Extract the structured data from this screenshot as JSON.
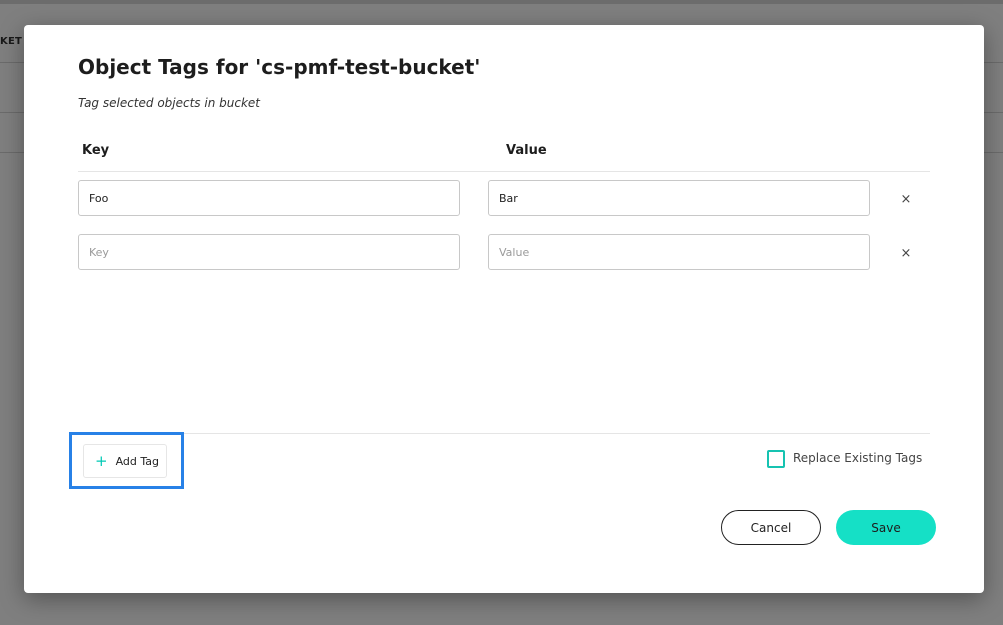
{
  "background": {
    "column_label": "KET C"
  },
  "modal": {
    "title": "Object Tags for 'cs-pmf-test-bucket'",
    "subtitle": "Tag selected objects in bucket",
    "headers": {
      "key": "Key",
      "value": "Value"
    },
    "tags": [
      {
        "key": "Foo",
        "value": "Bar",
        "key_placeholder": "Key",
        "value_placeholder": "Value",
        "remove_icon": "×"
      },
      {
        "key": "",
        "value": "",
        "key_placeholder": "Key",
        "value_placeholder": "Value",
        "remove_icon": "×"
      }
    ],
    "add_tag": {
      "icon": "+",
      "label": "Add Tag"
    },
    "replace_existing": {
      "label": "Replace Existing Tags",
      "checked": false
    },
    "buttons": {
      "cancel": "Cancel",
      "save": "Save"
    }
  },
  "colors": {
    "accent": "#15e0c6",
    "highlight": "#2781e7",
    "overlay": "#00000080"
  }
}
